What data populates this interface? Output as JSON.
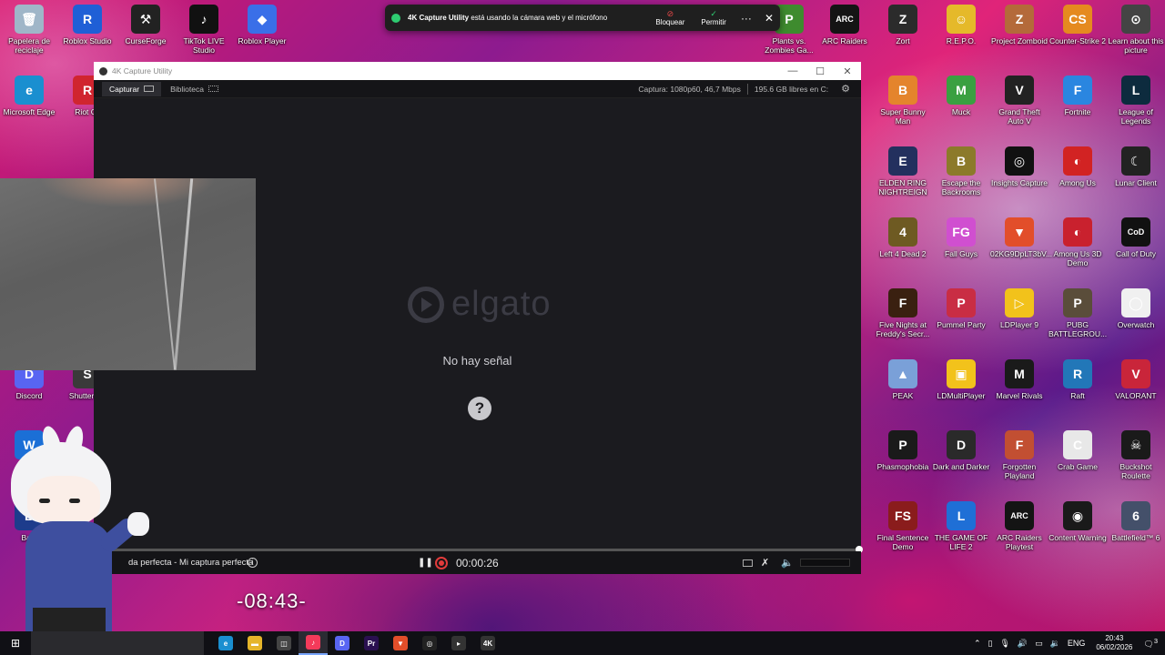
{
  "notification": {
    "app": "4K Capture Utility",
    "message": " está usando la cámara web y el micrófono",
    "block_label": "Bloquear",
    "allow_label": "Permitir"
  },
  "window": {
    "title": "4K Capture Utility",
    "tabs": [
      {
        "label": "Capturar"
      },
      {
        "label": "Biblioteca"
      }
    ],
    "capture_status": "Captura: 1080p60, 46,7 Mbps",
    "disk_status": "195.6 GB libres en C:",
    "logo_text": "elgato",
    "no_signal": "No hay señal",
    "capture_name": "da perfecta - Mi captura perfecta",
    "timer": "00:00:26",
    "progress": 1.0
  },
  "overlay_clock": "-08:43-",
  "desktop_left": [
    {
      "label": "Papelera de reciclaje",
      "color": "#9fb6c8",
      "glyph": "🗑"
    },
    {
      "label": "Roblox Studio",
      "color": "#1f5fd6",
      "glyph": "R"
    },
    {
      "label": "CurseForge",
      "color": "#222222",
      "glyph": "⚒"
    },
    {
      "label": "TikTok LIVE Studio",
      "color": "#111111",
      "glyph": "♪"
    },
    {
      "label": "Roblox Player",
      "color": "#3a6fe8",
      "glyph": "◆"
    },
    {
      "label": "Microsoft Edge",
      "color": "#1a8fd0",
      "glyph": "e"
    },
    {
      "label": "Riot Cli",
      "color": "#d0252f",
      "glyph": "R"
    },
    {
      "label": "Discord",
      "color": "#5865f2",
      "glyph": "D"
    },
    {
      "label": "Shutter En",
      "color": "#3a3a3a",
      "glyph": "S"
    },
    {
      "label": "Wall",
      "color": "#1b6fd6",
      "glyph": "W"
    },
    {
      "label": "Battl",
      "color": "#1d3c8c",
      "glyph": "B"
    }
  ],
  "desktop_mid": [
    {
      "label": "Plants vs. Zombies Ga...",
      "color": "#3e8b2e",
      "glyph": "P"
    },
    {
      "label": "ARC Raiders",
      "color": "#141414",
      "glyph": "ARC"
    }
  ],
  "desktop_right": [
    {
      "label": "Zort",
      "color": "#2b2b2b",
      "glyph": "Z"
    },
    {
      "label": "R.E.P.O.",
      "color": "#e5b92a",
      "glyph": "☺"
    },
    {
      "label": "Project Zomboid",
      "color": "#b46a3a",
      "glyph": "Z"
    },
    {
      "label": "Counter-Strike 2",
      "color": "#e58a1f",
      "glyph": "CS"
    },
    {
      "label": "Learn about this picture",
      "color": "#444444",
      "glyph": "⊙"
    },
    {
      "label": "Super Bunny Man",
      "color": "#e4842c",
      "glyph": "B"
    },
    {
      "label": "Muck",
      "color": "#3aa041",
      "glyph": "M"
    },
    {
      "label": "Grand Theft Auto V",
      "color": "#222222",
      "glyph": "V"
    },
    {
      "label": "Fortnite",
      "color": "#2a86e0",
      "glyph": "F"
    },
    {
      "label": "League of Legends",
      "color": "#0d2b3e",
      "glyph": "L"
    },
    {
      "label": "ELDEN RING NIGHTREIGN",
      "color": "#23305e",
      "glyph": "E"
    },
    {
      "label": "Escape the Backrooms",
      "color": "#8c7a2a",
      "glyph": "B"
    },
    {
      "label": "Insights Capture",
      "color": "#111111",
      "glyph": "◎"
    },
    {
      "label": "Among Us",
      "color": "#d22323",
      "glyph": "◐"
    },
    {
      "label": "Lunar Client",
      "color": "#222222",
      "glyph": "☾"
    },
    {
      "label": "Left 4 Dead 2",
      "color": "#6e5a22",
      "glyph": "4"
    },
    {
      "label": "Fall Guys",
      "color": "#d04fd0",
      "glyph": "FG"
    },
    {
      "label": "02KG9DpLT3bV...",
      "color": "#e24e2a",
      "glyph": "▼"
    },
    {
      "label": "Among Us 3D Demo",
      "color": "#c9212e",
      "glyph": "◐"
    },
    {
      "label": "Call of Duty",
      "color": "#111111",
      "glyph": "CoD"
    },
    {
      "label": "Five Nights at Freddy's Secr...",
      "color": "#3a2010",
      "glyph": "F"
    },
    {
      "label": "Pummel Party",
      "color": "#c92d44",
      "glyph": "P"
    },
    {
      "label": "LDPlayer 9",
      "color": "#f2c21b",
      "glyph": "▷"
    },
    {
      "label": "PUBG BATTLEGROU...",
      "color": "#5a4d3a",
      "glyph": "P"
    },
    {
      "label": "Overwatch",
      "color": "#f0f0f0",
      "glyph": "◯"
    },
    {
      "label": "PEAK",
      "color": "#7aa0d8",
      "glyph": "▲"
    },
    {
      "label": "LDMultiPlayer",
      "color": "#f2c21b",
      "glyph": "▣"
    },
    {
      "label": "Marvel Rivals",
      "color": "#1a1a1a",
      "glyph": "M"
    },
    {
      "label": "Raft",
      "color": "#2277b8",
      "glyph": "R"
    },
    {
      "label": "VALORANT",
      "color": "#c9253a",
      "glyph": "V"
    },
    {
      "label": "Phasmophobia",
      "color": "#1a1a1a",
      "glyph": "P"
    },
    {
      "label": "Dark and Darker",
      "color": "#2a2a2a",
      "glyph": "D"
    },
    {
      "label": "Forgotten Playland",
      "color": "#c24f32",
      "glyph": "F"
    },
    {
      "label": "Crab Game",
      "color": "#e8e8e8",
      "glyph": "C"
    },
    {
      "label": "Buckshot Roulette",
      "color": "#1a1a1a",
      "glyph": "☠"
    },
    {
      "label": "Final Sentence Demo",
      "color": "#8a1c1c",
      "glyph": "FS"
    },
    {
      "label": "THE GAME OF LIFE 2",
      "color": "#1f6fd6",
      "glyph": "L"
    },
    {
      "label": "ARC Raiders Playtest",
      "color": "#141414",
      "glyph": "ARC"
    },
    {
      "label": "Content Warning",
      "color": "#1a1a1a",
      "glyph": "◉"
    },
    {
      "label": "Battlefield™ 6",
      "color": "#44506a",
      "glyph": "6"
    }
  ],
  "taskbar": {
    "apps": [
      {
        "name": "edge",
        "glyph": "e",
        "color": "#1a8fd0"
      },
      {
        "name": "explorer",
        "glyph": "▬",
        "color": "#e5b52a"
      },
      {
        "name": "store",
        "glyph": "◫",
        "color": "#444"
      },
      {
        "name": "music",
        "glyph": "♪",
        "color": "#f43a5a"
      },
      {
        "name": "discord",
        "glyph": "D",
        "color": "#5865f2"
      },
      {
        "name": "premiere",
        "glyph": "Pr",
        "color": "#2a1050"
      },
      {
        "name": "brave",
        "glyph": "▼",
        "color": "#e24e2a"
      },
      {
        "name": "insights",
        "glyph": "◎",
        "color": "#222"
      },
      {
        "name": "player",
        "glyph": "▸",
        "color": "#333"
      },
      {
        "name": "4k",
        "glyph": "4K",
        "color": "#333"
      }
    ],
    "lang": "ENG",
    "time": "20:43",
    "date": "06/02/2026",
    "notif_count": "3"
  }
}
